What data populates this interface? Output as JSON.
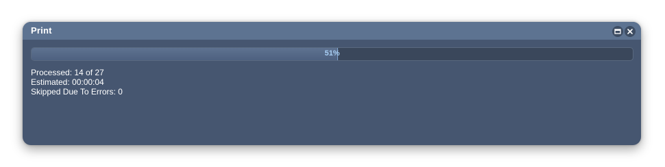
{
  "dialog": {
    "title": "Print",
    "buttons": {
      "maximize_icon": "maximize-icon",
      "close_icon": "close-icon"
    }
  },
  "progress": {
    "percent": 51,
    "label": "51%"
  },
  "stats": {
    "processed": "Processed: 14 of 27",
    "estimated": "Estimated: 00:00:04",
    "skipped": "Skipped Due To Errors: 0"
  },
  "colors": {
    "dialog_bg": "#465670",
    "titlebar_bg": "#5d7391",
    "progress_text": "#a7cdf3"
  }
}
